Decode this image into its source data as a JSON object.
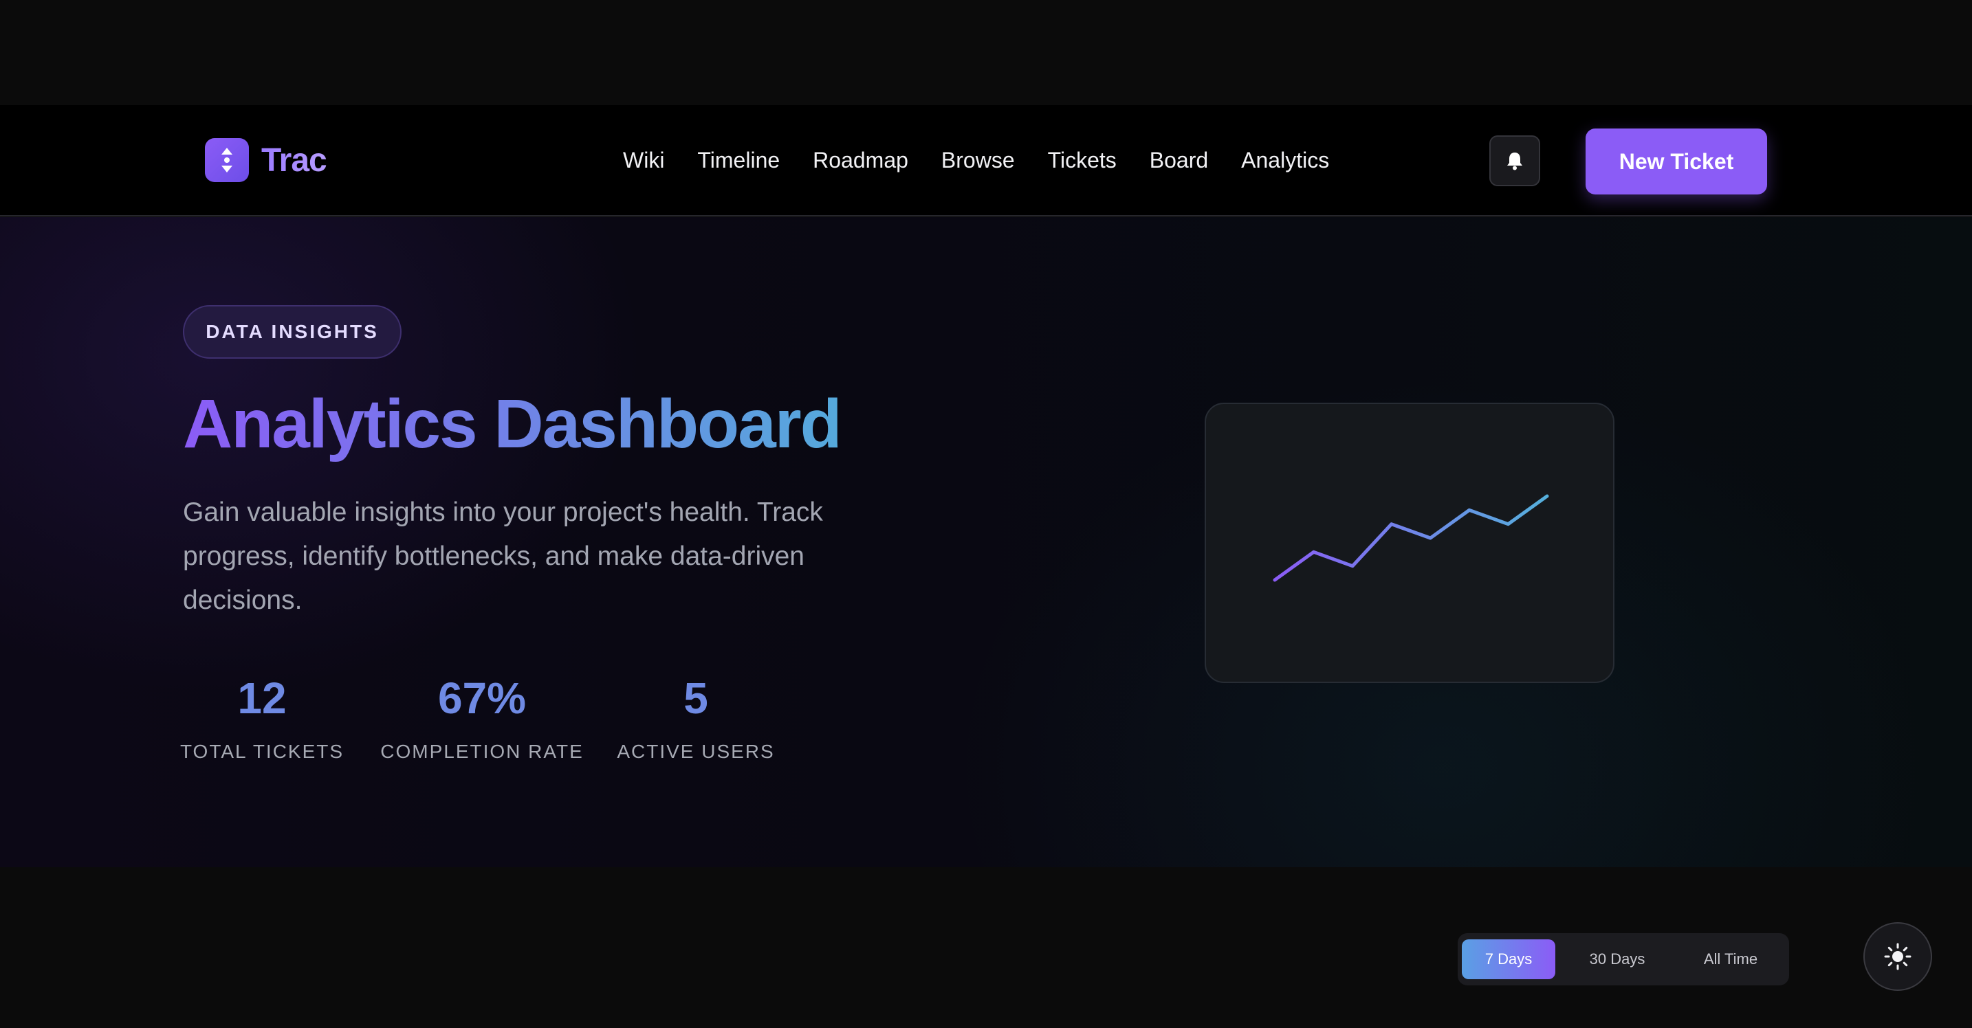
{
  "brand": {
    "name": "Trac",
    "accent": "#8b5cf6"
  },
  "nav": {
    "links": [
      "Wiki",
      "Timeline",
      "Roadmap",
      "Browse",
      "Tickets",
      "Board",
      "Analytics"
    ],
    "notifications_icon": "bell-icon",
    "new_ticket_label": "New Ticket"
  },
  "hero": {
    "badge": "DATA INSIGHTS",
    "title": "Analytics Dashboard",
    "description": "Gain valuable insights into your project's health. Track progress, identify bottlenecks, and make data-driven decisions.",
    "stats": [
      {
        "value": "12",
        "label": "TOTAL TICKETS"
      },
      {
        "value": "67%",
        "label": "COMPLETION RATE"
      },
      {
        "value": "5",
        "label": "ACTIVE USERS"
      }
    ]
  },
  "sparkline": {
    "values": [
      0,
      2,
      1,
      4,
      3,
      5,
      4,
      6
    ],
    "gradient": [
      "#8b5cf6",
      "#55b0dc"
    ]
  },
  "range": {
    "options": [
      "7 Days",
      "30 Days",
      "All Time"
    ],
    "selected": "7 Days"
  },
  "theme_toggle_icon": "sun-icon"
}
